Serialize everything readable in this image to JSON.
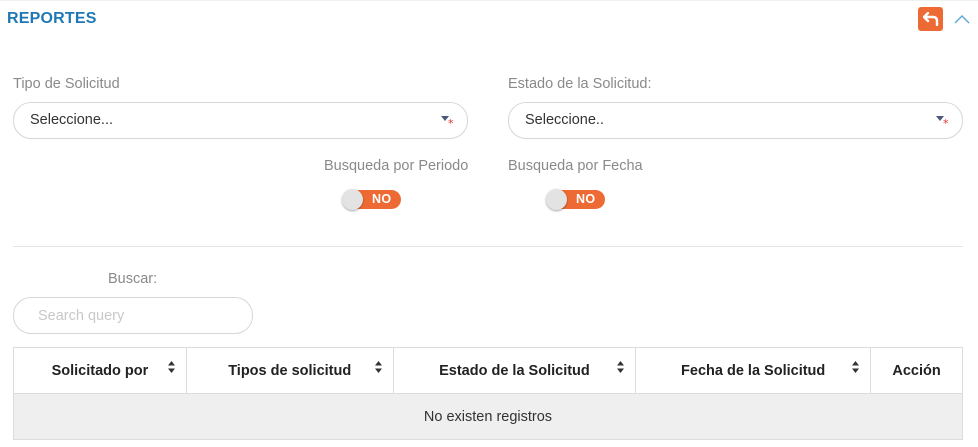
{
  "header": {
    "title": "REPORTES",
    "accent_color": "#1f78b4",
    "back_button_color": "#ee6a35",
    "back_icon": "undo-arrow-icon",
    "collapse_icon": "chevron-up-icon"
  },
  "filters": {
    "tipo_label": "Tipo de Solicitud",
    "tipo_value": "Seleccione...",
    "estado_label": "Estado de la Solicitud:",
    "estado_value": "Seleccione..",
    "periodo_label": "Busqueda por Periodo",
    "periodo_toggle": "NO",
    "fecha_label": "Busqueda por Fecha",
    "fecha_toggle": "NO",
    "toggle_color": "#ee6a35"
  },
  "search": {
    "label": "Buscar:",
    "placeholder": "Search query",
    "value": ""
  },
  "table": {
    "columns": [
      "Solicitado por",
      "Tipos de solicitud",
      "Estado de la Solicitud",
      "Fecha de la Solicitud",
      "Acción"
    ],
    "empty_message": "No existen registros"
  }
}
